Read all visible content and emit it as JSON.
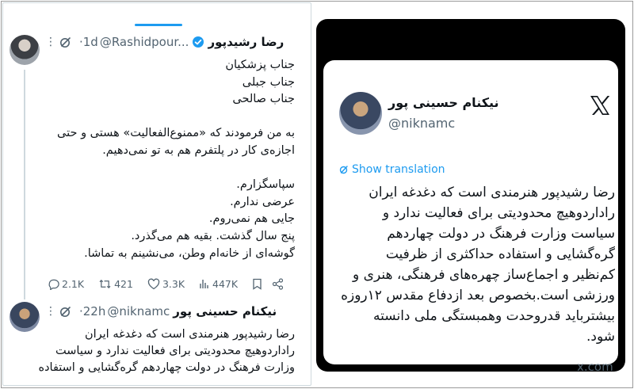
{
  "left_tweet_1": {
    "name": "رضا رشیدپور",
    "handle": "@Rashidpour...",
    "time": "·1d",
    "more": "⋮",
    "lines": [
      [
        "جناب پزشکیان",
        "جناب جبلی",
        "جناب صالحی"
      ],
      [
        "به من فرمودند که «ممنوع‌الفعالیت» هستی و حتی اجازه‌ی کار در پلتفرم هم به تو نمی‌دهیم."
      ],
      [
        "سپاسگزارم.",
        "عرضی ندارم.",
        "جایی هم نمی‌روم.",
        "پنج سال گذشت. بقیه هم می‌گذرد.",
        "گوشه‌ای از خانه‌ام وطن، می‌نشینم به تماشا."
      ]
    ],
    "actions": {
      "replies": "2.1K",
      "reposts": "421",
      "likes": "3.3K",
      "views": "447K"
    }
  },
  "left_tweet_2": {
    "name": "نیکنام حسینی پور",
    "handle": "@niknamc",
    "time": "·22h",
    "more": "⋮",
    "lines": [
      "رضا رشیدپور هنرمندی است که دغدغه ایران",
      "رادارد‌وهیچ محدودیتی برای فعالیت ندارد و سیاست",
      "وزارت فرهنگ در دولت چهاردهم گره‌گشایی و استفاده"
    ]
  },
  "right_card": {
    "name": "نیکنام حسینی پور",
    "handle": "@niknamc",
    "translate_label": "Show translation",
    "body": "رضا رشیدپور هنرمندی است که دغدغه ایران رادارد‌وهیچ محدودیتی برای فعالیت ندارد و سیاست وزارت فرهنگ در دولت چهاردهم گره‌گشایی و استفاده حداکثری از ظرفیت کم‌نظیر و اجماع‌ساز چهره‌های فرهنگی، هنری و ورزشی است.بخصوص بعد ازدفاع مقدس ۱۲روزه بیشترباید قدروحدت وهمبستگی ملی دانسته شود.",
    "domain": "x.com"
  },
  "colors": {
    "accent_blue": "#1d9bf0",
    "secondary_text": "#536471",
    "right_panel_bg": "#000000"
  }
}
